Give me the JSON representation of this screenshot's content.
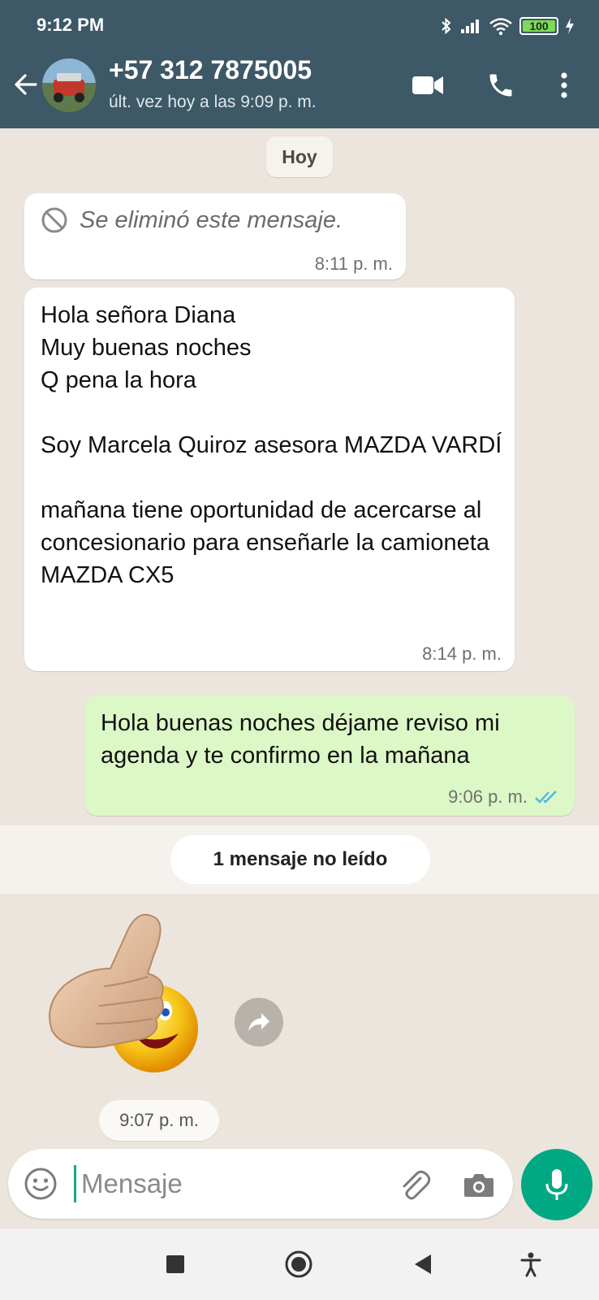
{
  "status_bar": {
    "time": "9:12 PM",
    "battery": "100"
  },
  "header": {
    "contact_name": "+57 312 7875005",
    "last_seen": "últ. vez hoy a las 9:09 p. m."
  },
  "chat": {
    "date_chip": "Hoy",
    "messages": [
      {
        "direction": "in",
        "type": "deleted",
        "text": "Se eliminó este mensaje.",
        "time": "8:11 p. m."
      },
      {
        "direction": "in",
        "type": "text",
        "text": "Hola señora Diana\nMuy buenas noches\nQ pena la hora\n\nSoy Marcela Quiroz asesora MAZDA VARDÍ\n\nmañana tiene oportunidad de acercarse al concesionario para enseñarle la camioneta MAZDA CX5",
        "time": "8:14 p. m."
      },
      {
        "direction": "out",
        "type": "text",
        "text": "Hola buenas noches déjame reviso mi agenda y te confirmo en la mañana",
        "time": "9:06 p. m.",
        "status": "read"
      },
      {
        "direction": "in",
        "type": "sticker",
        "sticker": "thumbs-up-smiley",
        "time": "9:07 p. m."
      }
    ],
    "unread_label": "1 mensaje no leído"
  },
  "input": {
    "placeholder": "Mensaje"
  },
  "colors": {
    "header": "#3d5866",
    "accent": "#00a884",
    "outgoing": "#dcf8c6",
    "read_ticks": "#4fb6ec"
  }
}
